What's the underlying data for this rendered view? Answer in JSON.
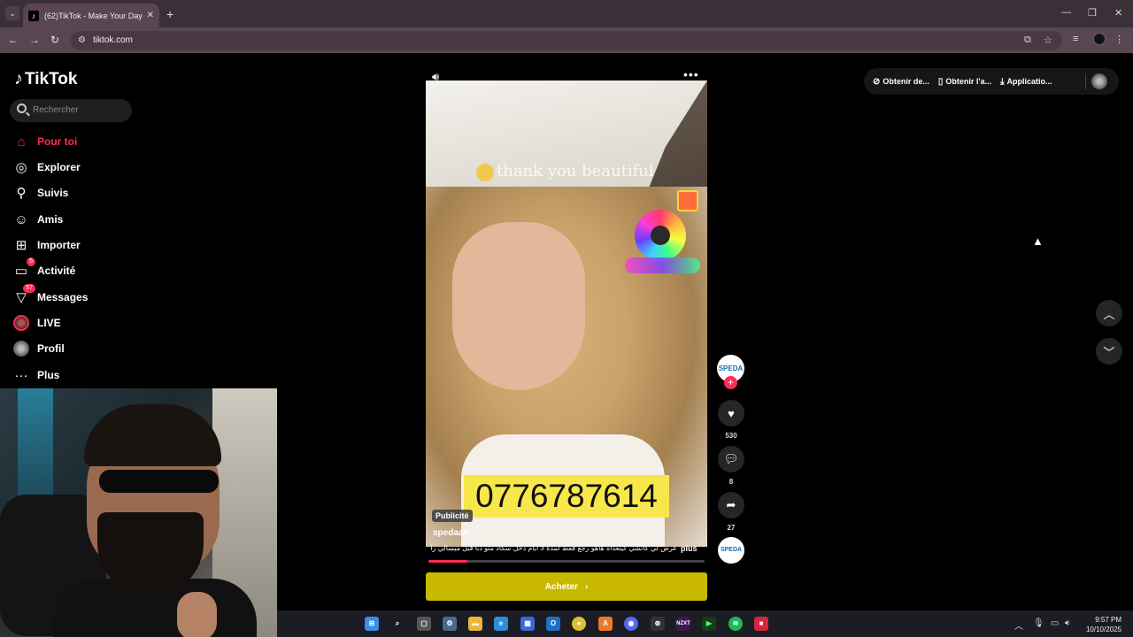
{
  "browser": {
    "tab_title": "(62)TikTok - Make Your Day",
    "url": "tiktok.com"
  },
  "tiktok": {
    "logo": "TikTok",
    "search_placeholder": "Rechercher",
    "nav": [
      {
        "label": "Pour toi",
        "icon": "home-icon",
        "active": true
      },
      {
        "label": "Explorer",
        "icon": "compass-icon"
      },
      {
        "label": "Suivis",
        "icon": "following-icon"
      },
      {
        "label": "Amis",
        "icon": "friends-icon"
      },
      {
        "label": "Importer",
        "icon": "upload-icon"
      },
      {
        "label": "Activité",
        "icon": "activity-icon",
        "badge": "5"
      },
      {
        "label": "Messages",
        "icon": "messages-icon",
        "badge": "57"
      },
      {
        "label": "LIVE",
        "icon": "live-icon"
      },
      {
        "label": "Profil",
        "icon": "profile-icon"
      },
      {
        "label": "Plus",
        "icon": "more-icon"
      }
    ],
    "top_right": {
      "coins": "Obtenir de...",
      "app": "Obtenir l'a...",
      "desktop": "Applicatio..."
    },
    "video": {
      "caption_overlay": "thank you beautiful",
      "phone_overlay": "0776787614",
      "tag": "Publicité",
      "author": "spedaax",
      "description": "عرض لي كاتشي كيتعداه هاهو رجع فقط لمدة 3 ايام دخل سكاد متو دبا قبل ميسالي راه الكمية",
      "more": "plus",
      "progress": 0.14,
      "cta": "Acheter"
    },
    "actions": {
      "avatar_text": "SPEDA",
      "likes": "530",
      "comments": "8",
      "shares": "27"
    }
  },
  "taskbar": {
    "time": "9:57 PM",
    "date": "10/10/2025"
  }
}
